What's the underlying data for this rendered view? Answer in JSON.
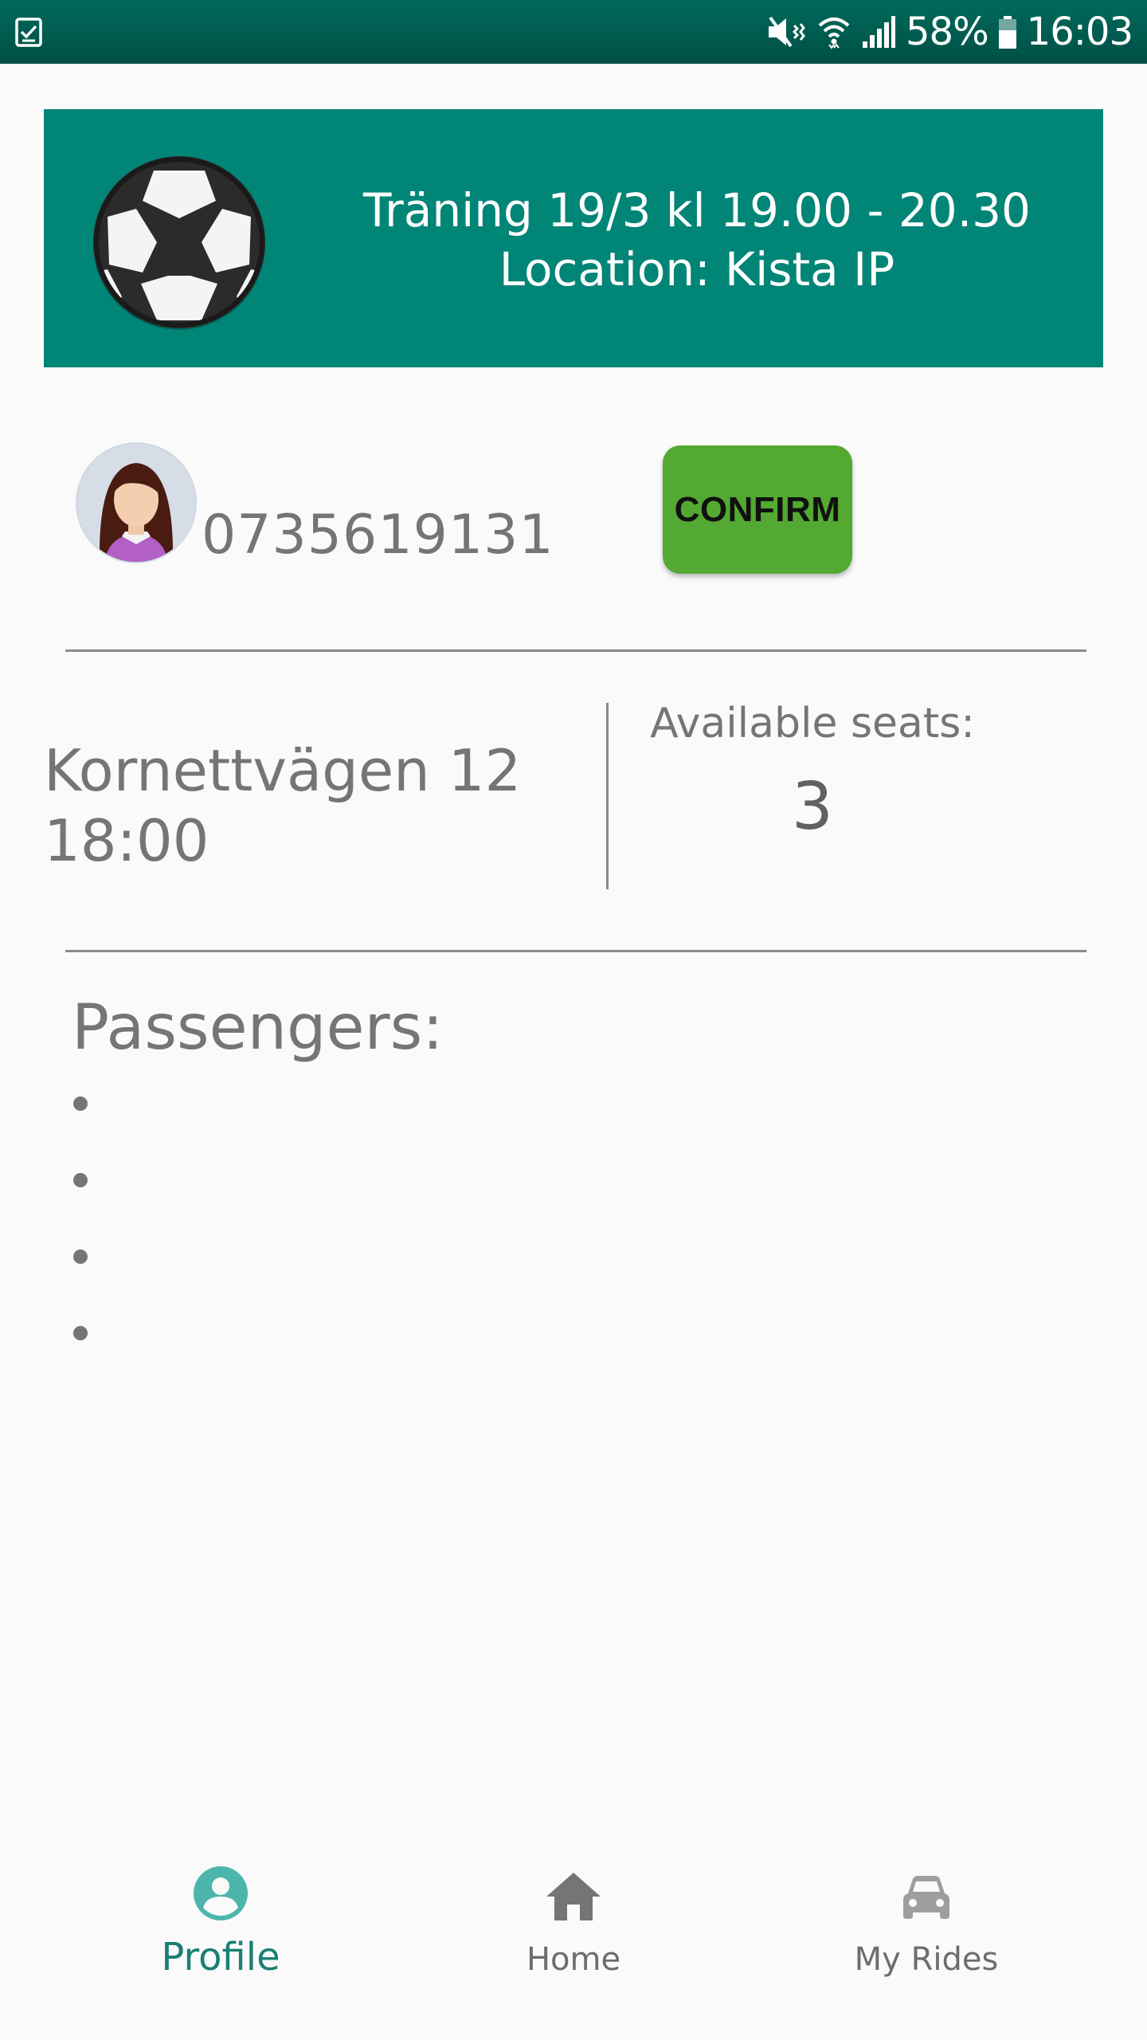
{
  "status_bar": {
    "battery": "58%",
    "time": "16:03",
    "icons": [
      "task-icon",
      "mute-icon",
      "wifi-icon",
      "signal-icon",
      "battery-icon"
    ]
  },
  "event": {
    "title": "Träning 19/3 kl 19.00 - 20.30",
    "location": "Location: Kista IP",
    "icon": "soccer-ball-icon"
  },
  "driver": {
    "phone": "0735619131",
    "confirm_label": "CONFIRM"
  },
  "ride": {
    "address": "Kornettvägen 12",
    "time": "18:00",
    "seats_label": "Available seats:",
    "seats_value": "3"
  },
  "passengers": {
    "title": "Passengers:",
    "items": [
      "",
      "",
      "",
      ""
    ]
  },
  "bottom_nav": {
    "items": [
      {
        "label": "Profile",
        "icon": "profile-icon",
        "active": true
      },
      {
        "label": "Home",
        "icon": "home-icon",
        "active": false
      },
      {
        "label": "My Rides",
        "icon": "car-icon",
        "active": false
      }
    ]
  },
  "colors": {
    "status_bar": "#00574b",
    "banner": "#018577",
    "confirm": "#53a931",
    "active_nav": "#1a7f73",
    "text_gray": "#757575"
  }
}
